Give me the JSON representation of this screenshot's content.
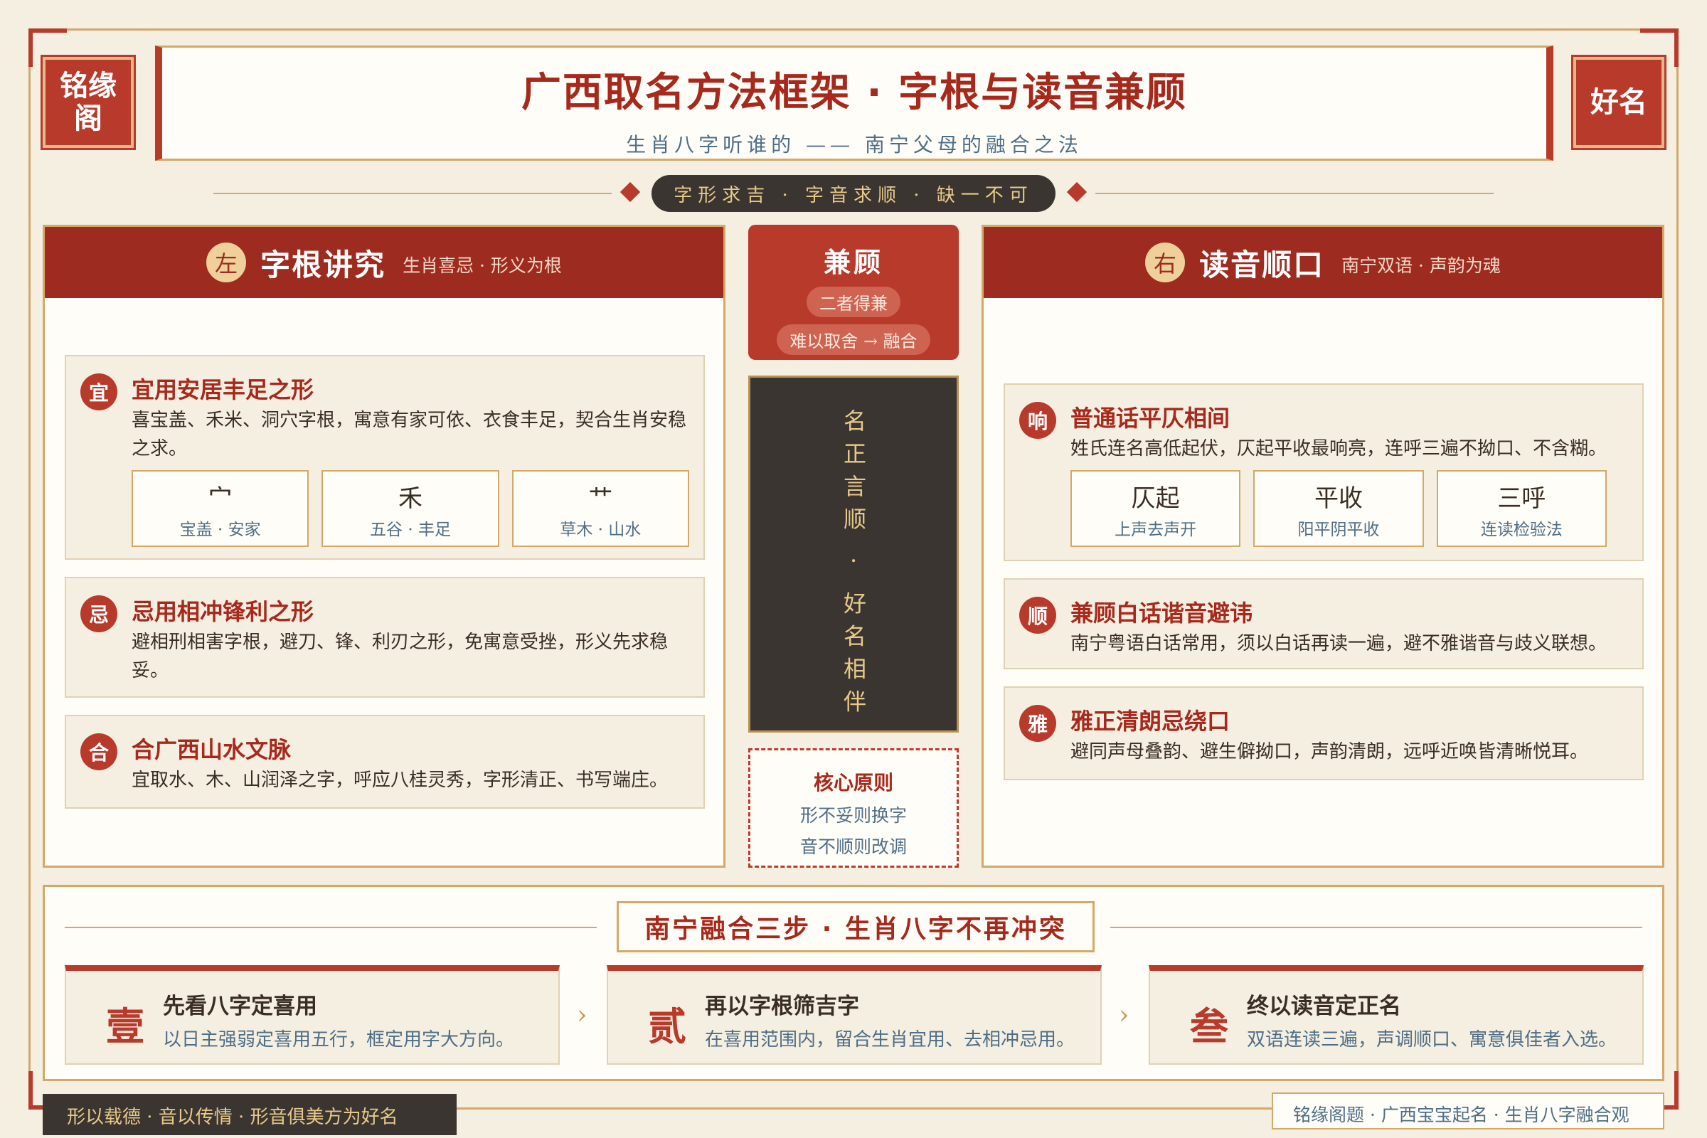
{
  "seals": {
    "left": "铭缘阁",
    "right": "好名"
  },
  "header": {
    "title": "广西取名方法框架 · 字根与读音兼顾",
    "subtitle": "生肖八字听谁的 —— 南宁父母的融合之法"
  },
  "motto": "字形求吉 · 字音求顺 · 缺一不可",
  "left_col": {
    "badge": "左",
    "title": "字根讲究",
    "subtitle": "生肖喜忌 · 形义为根",
    "cards": [
      {
        "mark": "宜",
        "title": "宜用安居丰足之形",
        "desc": "喜宝盖、禾米、洞穴字根，寓意有家可依、衣食丰足，契合生肖安稳之求。",
        "chips": [
          {
            "char": "宀",
            "sub": "宝盖 · 安家"
          },
          {
            "char": "禾",
            "sub": "五谷 · 丰足"
          },
          {
            "char": "艹",
            "sub": "草木 · 山水"
          }
        ]
      },
      {
        "mark": "忌",
        "title": "忌用相冲锋利之形",
        "desc": "避相刑相害字根，避刀、锋、利刃之形，免寓意受挫，形义先求稳妥。"
      },
      {
        "mark": "合",
        "title": "合广西山水文脉",
        "desc": "宜取水、木、山润泽之字，呼应八桂灵秀，字形清正、书写端庄。"
      }
    ]
  },
  "right_col": {
    "badge": "右",
    "title": "读音顺口",
    "subtitle": "南宁双语 · 声韵为魂",
    "cards": [
      {
        "mark": "响",
        "title": "普通话平仄相间",
        "desc": "姓氏连名高低起伏，仄起平收最响亮，连呼三遍不拗口、不含糊。",
        "chips": [
          {
            "char": "仄起",
            "sub": "上声去声开"
          },
          {
            "char": "平收",
            "sub": "阳平阴平收"
          },
          {
            "char": "三呼",
            "sub": "连读检验法"
          }
        ]
      },
      {
        "mark": "顺",
        "title": "兼顾白话谐音避讳",
        "desc": "南宁粤语白话常用，须以白话再读一遍，避不雅谐音与歧义联想。"
      },
      {
        "mark": "雅",
        "title": "雅正清朗忌绕口",
        "desc": "避同声母叠韵、避生僻拗口，声韵清朗，远呼近唤皆清晰悦耳。"
      }
    ]
  },
  "middle": {
    "title": "兼顾",
    "pill1": "二者得兼",
    "pill2": "难以取舍 → 融合",
    "vertical": "名正言顺 · 好名相伴",
    "core_title": "核心原则",
    "core_line1": "形不妥则换字",
    "core_line2": "音不顺则改调"
  },
  "bottom": {
    "title": "南宁融合三步 · 生肖八字不再冲突",
    "steps": [
      {
        "num": "壹",
        "title": "先看八字定喜用",
        "desc": "以日主强弱定喜用五行，框定用字大方向。"
      },
      {
        "num": "贰",
        "title": "再以字根筛吉字",
        "desc": "在喜用范围内，留合生肖宜用、去相冲忌用。"
      },
      {
        "num": "叁",
        "title": "终以读音定正名",
        "desc": "双语连读三遍，声调顺口、寓意俱佳者入选。"
      }
    ],
    "arrow": "›"
  },
  "footer": {
    "left": "形以载德 · 音以传情 · 形音俱美方为好名",
    "right": "铭缘阁题 · 广西宝宝起名 · 生肖八字融合观"
  },
  "colors": {
    "accent": "#b83a2b",
    "dark": "#3a3530",
    "gold": "#d4a867",
    "paper": "#f5efe2"
  }
}
